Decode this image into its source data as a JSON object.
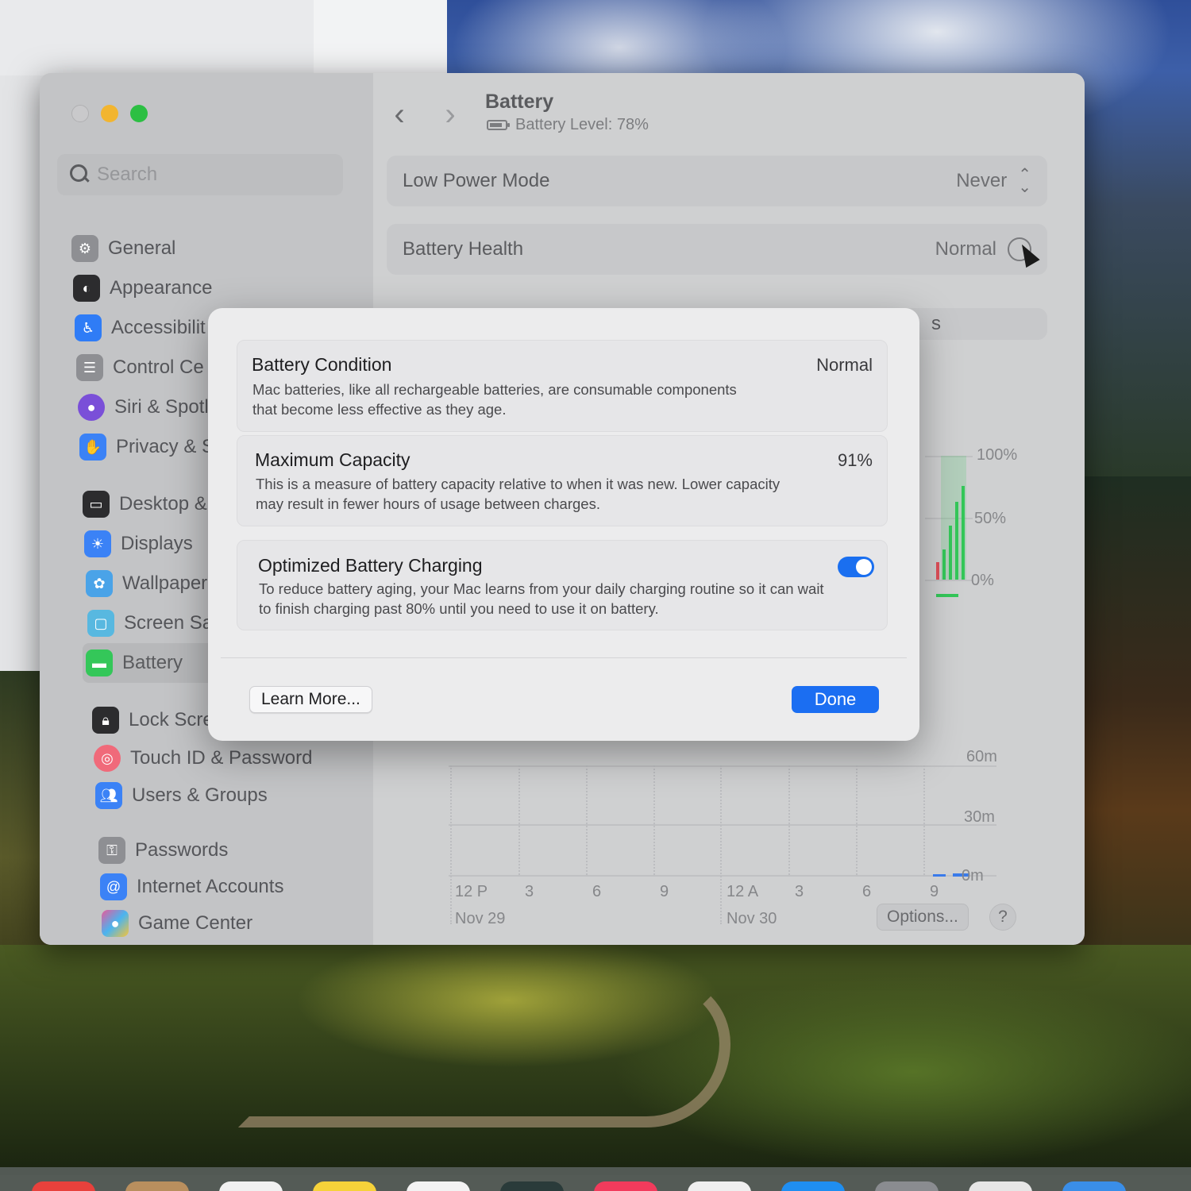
{
  "window": {
    "title": "Battery",
    "subtitle": "Battery Level: 78%"
  },
  "search": {
    "placeholder": "Search"
  },
  "sidebar": {
    "items": [
      {
        "label": "General",
        "icon": "gear-icon",
        "color": "#8e8f93"
      },
      {
        "label": "Appearance",
        "icon": "appearance-icon",
        "color": "#2c2c2e"
      },
      {
        "label": "Accessibilit",
        "icon": "accessibility-icon",
        "color": "#2f7cf6"
      },
      {
        "label": "Control Ce",
        "icon": "control-center-icon",
        "color": "#8e8f93"
      },
      {
        "label": "Siri & Spotl",
        "icon": "siri-icon",
        "color": "#7a4fd8"
      },
      {
        "label": "Privacy & S",
        "icon": "hand-icon",
        "color": "#3b82f6"
      },
      {
        "label": "Desktop &",
        "icon": "desktop-icon",
        "color": "#2c2c2e"
      },
      {
        "label": "Displays",
        "icon": "sun-icon",
        "color": "#3b82f6"
      },
      {
        "label": "Wallpaper",
        "icon": "flower-icon",
        "color": "#4aa3e8"
      },
      {
        "label": "Screen Sav",
        "icon": "screensaver-icon",
        "color": "#58b8e0"
      },
      {
        "label": "Battery",
        "icon": "battery-icon",
        "color": "#34c759"
      },
      {
        "label": "Lock Scree",
        "icon": "lock-icon",
        "color": "#2c2c2e"
      },
      {
        "label": "Touch ID & Password",
        "icon": "fingerprint-icon",
        "color": "#f06a7a"
      },
      {
        "label": "Users & Groups",
        "icon": "users-icon",
        "color": "#3b82f6"
      },
      {
        "label": "Passwords",
        "icon": "key-icon",
        "color": "#8e8f93"
      },
      {
        "label": "Internet Accounts",
        "icon": "at-icon",
        "color": "#3b82f6"
      },
      {
        "label": "Game Center",
        "icon": "game-center-icon",
        "color": "#e85a9a"
      }
    ]
  },
  "main": {
    "low_power_mode": {
      "label": "Low Power Mode",
      "value": "Never"
    },
    "battery_health": {
      "label": "Battery Health",
      "value": "Normal"
    },
    "partial_letter": "s",
    "chart_level": {
      "y_ticks": [
        "100%",
        "50%",
        "0%"
      ]
    },
    "chart_usage": {
      "y_ticks": [
        "60m",
        "30m",
        "0m"
      ],
      "x_ticks": [
        "12 P",
        "3",
        "6",
        "9",
        "12 A",
        "3",
        "6",
        "9"
      ],
      "dates": [
        "Nov 29",
        "Nov 30"
      ]
    },
    "options_label": "Options...",
    "help_label": "?"
  },
  "sheet": {
    "battery_condition": {
      "title": "Battery Condition",
      "value": "Normal",
      "desc": "Mac batteries, like all rechargeable batteries, are consumable components that become less effective as they age."
    },
    "maximum_capacity": {
      "title": "Maximum Capacity",
      "value": "91%",
      "desc": "This is a measure of battery capacity relative to when it was new. Lower capacity may result in fewer hours of usage between charges."
    },
    "optimized_charging": {
      "title": "Optimized Battery Charging",
      "enabled": true,
      "desc": "To reduce battery aging, your Mac learns from your daily charging routine so it can wait to finish charging past 80% until you need to use it on battery."
    },
    "learn_more_label": "Learn More...",
    "done_label": "Done"
  }
}
